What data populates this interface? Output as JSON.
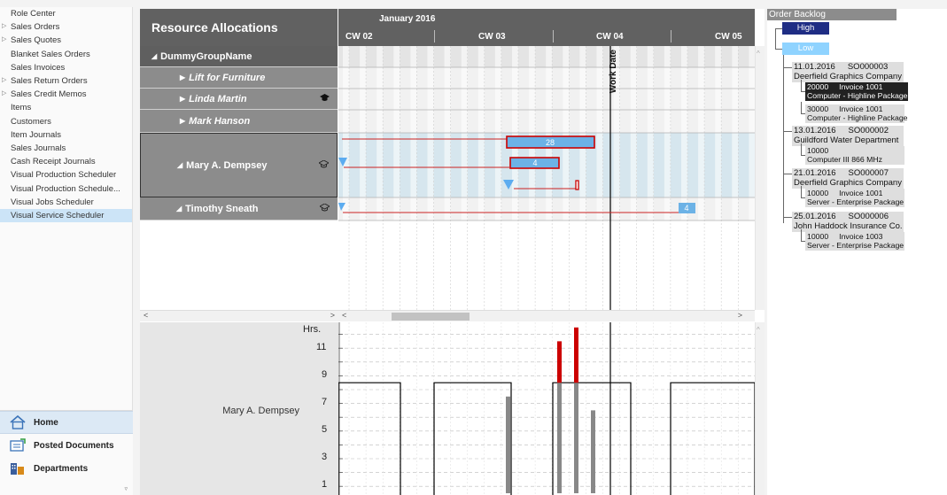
{
  "nav": {
    "items": [
      {
        "label": "Role Center",
        "expandable": false
      },
      {
        "label": "Sales Orders",
        "expandable": true
      },
      {
        "label": "Sales Quotes",
        "expandable": true
      },
      {
        "label": "Blanket Sales Orders",
        "expandable": false
      },
      {
        "label": "Sales Invoices",
        "expandable": false
      },
      {
        "label": "Sales Return Orders",
        "expandable": true
      },
      {
        "label": "Sales Credit Memos",
        "expandable": true
      },
      {
        "label": "Items",
        "expandable": false
      },
      {
        "label": "Customers",
        "expandable": false
      },
      {
        "label": "Item Journals",
        "expandable": false
      },
      {
        "label": "Sales Journals",
        "expandable": false
      },
      {
        "label": "Cash Receipt Journals",
        "expandable": false
      },
      {
        "label": "Visual Production Scheduler",
        "expandable": false
      },
      {
        "label": "Visual Production Schedule...",
        "expandable": false
      },
      {
        "label": "Visual Jobs Scheduler",
        "expandable": false
      },
      {
        "label": "Visual Service Scheduler",
        "expandable": false,
        "selected": true
      }
    ],
    "bottom": [
      {
        "label": "Home",
        "icon": "home-icon",
        "active": true
      },
      {
        "label": "Posted Documents",
        "icon": "posted-documents-icon",
        "active": false
      },
      {
        "label": "Departments",
        "icon": "departments-icon",
        "active": false
      }
    ]
  },
  "resources": {
    "header": "Resource Allocations",
    "rows": [
      {
        "label": "DummyGroupName",
        "glyph": "◢",
        "italic": false
      },
      {
        "label": "Lift for Furniture",
        "glyph": "▶",
        "italic": true
      },
      {
        "label": "Linda Martin",
        "glyph": "▶",
        "italic": true,
        "icon": "graduation-cap-icon"
      },
      {
        "label": "Mark Hanson",
        "glyph": "▶",
        "italic": true
      },
      {
        "label": "Mary A. Dempsey",
        "glyph": "◢",
        "italic": false,
        "icon": "cap-outline-icon"
      },
      {
        "label": "Timothy Sneath",
        "glyph": "◢",
        "italic": false,
        "icon": "cap-outline-icon"
      }
    ]
  },
  "gantt": {
    "month": "January 2016",
    "weeks": [
      "CW 02",
      "CW 03",
      "CW 04",
      "CW 05"
    ],
    "work_date_label": "Work Date",
    "bars": [
      {
        "label": "28"
      },
      {
        "label": "4"
      },
      {
        "label": "4"
      }
    ]
  },
  "capacity_chart": {
    "resource": "Mary A. Dempsey",
    "unit": "Hrs.",
    "y_ticks": [
      "11",
      "9",
      "7",
      "5",
      "3",
      "1"
    ]
  },
  "chart_data": {
    "type": "bar",
    "title": "",
    "ylabel": "Hrs.",
    "ylim": [
      0,
      12.5
    ],
    "y_ticks": [
      1,
      3,
      5,
      7,
      9,
      11
    ],
    "capacity_line": 8,
    "series": [
      {
        "name": "",
        "color": "#888888",
        "values": [
          7,
          8,
          8,
          6
        ]
      },
      {
        "name": "",
        "color": "#cc0000",
        "values": [
          0,
          3,
          4,
          0
        ]
      }
    ]
  },
  "backlog": {
    "title": "Order Backlog",
    "priority_high": "High",
    "priority_low": "Low",
    "orders": [
      {
        "date": "11.01.2016",
        "order_no": "SO000003",
        "customer": "Deerfield Graphics Company",
        "lines": [
          {
            "qty": "20000",
            "invoice": "Invoice 1001",
            "desc": "Computer - Highline Package",
            "selected": true
          },
          {
            "qty": "30000",
            "invoice": "Invoice 1001",
            "desc": "Computer - Highline Package",
            "selected": false
          }
        ]
      },
      {
        "date": "13.01.2016",
        "order_no": "SO000002",
        "customer": "Guildford Water Department",
        "lines": [
          {
            "qty": "10000",
            "invoice": "",
            "desc": "Computer III 866 MHz",
            "selected": false
          }
        ]
      },
      {
        "date": "21.01.2016",
        "order_no": "SO000007",
        "customer": "Deerfield Graphics Company",
        "lines": [
          {
            "qty": "10000",
            "invoice": "Invoice 1001",
            "desc": "Server - Enterprise Package",
            "selected": false
          }
        ]
      },
      {
        "date": "25.01.2016",
        "order_no": "SO000006",
        "customer": "John Haddock Insurance Co.",
        "lines": [
          {
            "qty": "10000",
            "invoice": "Invoice 1003",
            "desc": "Server - Enterprise Package",
            "selected": false
          }
        ]
      }
    ]
  }
}
